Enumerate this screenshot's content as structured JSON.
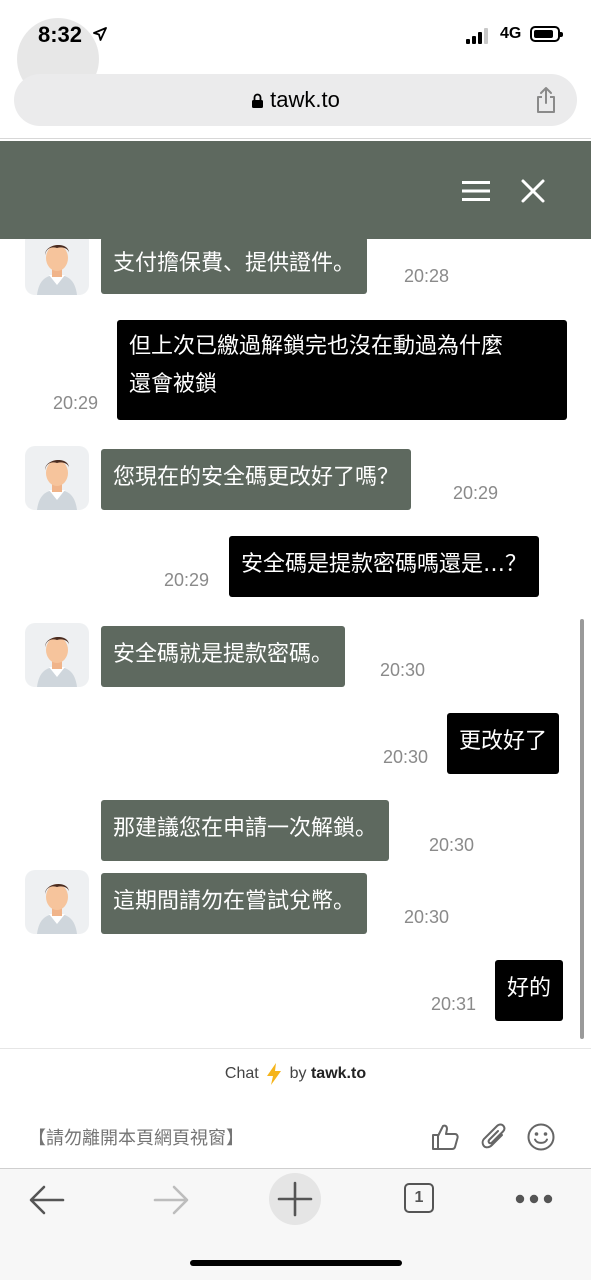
{
  "status": {
    "time": "8:32",
    "network": "4G"
  },
  "browser": {
    "url": "tawk.to"
  },
  "messages": [
    {
      "from": "agent",
      "text": "支付擔保費、提供證件。",
      "time": "20:28"
    },
    {
      "from": "user",
      "lines": [
        "但上次已繳過解鎖完也沒在動過為什麼",
        "還會被鎖"
      ],
      "time": "20:29"
    },
    {
      "from": "agent",
      "text": "您現在的安全碼更改好了嗎？",
      "time": "20:29"
    },
    {
      "from": "user",
      "text": "安全碼是提款密碼嗎還是…？",
      "time": "20:29"
    },
    {
      "from": "agent",
      "text": "安全碼就是提款密碼。",
      "time": "20:30"
    },
    {
      "from": "user",
      "text": "更改好了",
      "time": "20:30"
    },
    {
      "from": "agent",
      "text": "那建議您在申請一次解鎖。",
      "time": "20:30"
    },
    {
      "from": "agent",
      "text": "這期間請勿在嘗試兌幣。",
      "time": "20:30"
    },
    {
      "from": "user",
      "text": "好的",
      "time": "20:31"
    }
  ],
  "footer": {
    "chat_label": "Chat",
    "by_label": "by",
    "brand": "tawk.to"
  },
  "composer": {
    "placeholder": "【請勿離開本頁網頁視窗】"
  },
  "toolbar": {
    "tab_count": "1"
  },
  "colors": {
    "header": "#5e695f",
    "agent_bubble": "#5e695f",
    "user_bubble": "#000000",
    "bolt": "#f5b41a"
  }
}
